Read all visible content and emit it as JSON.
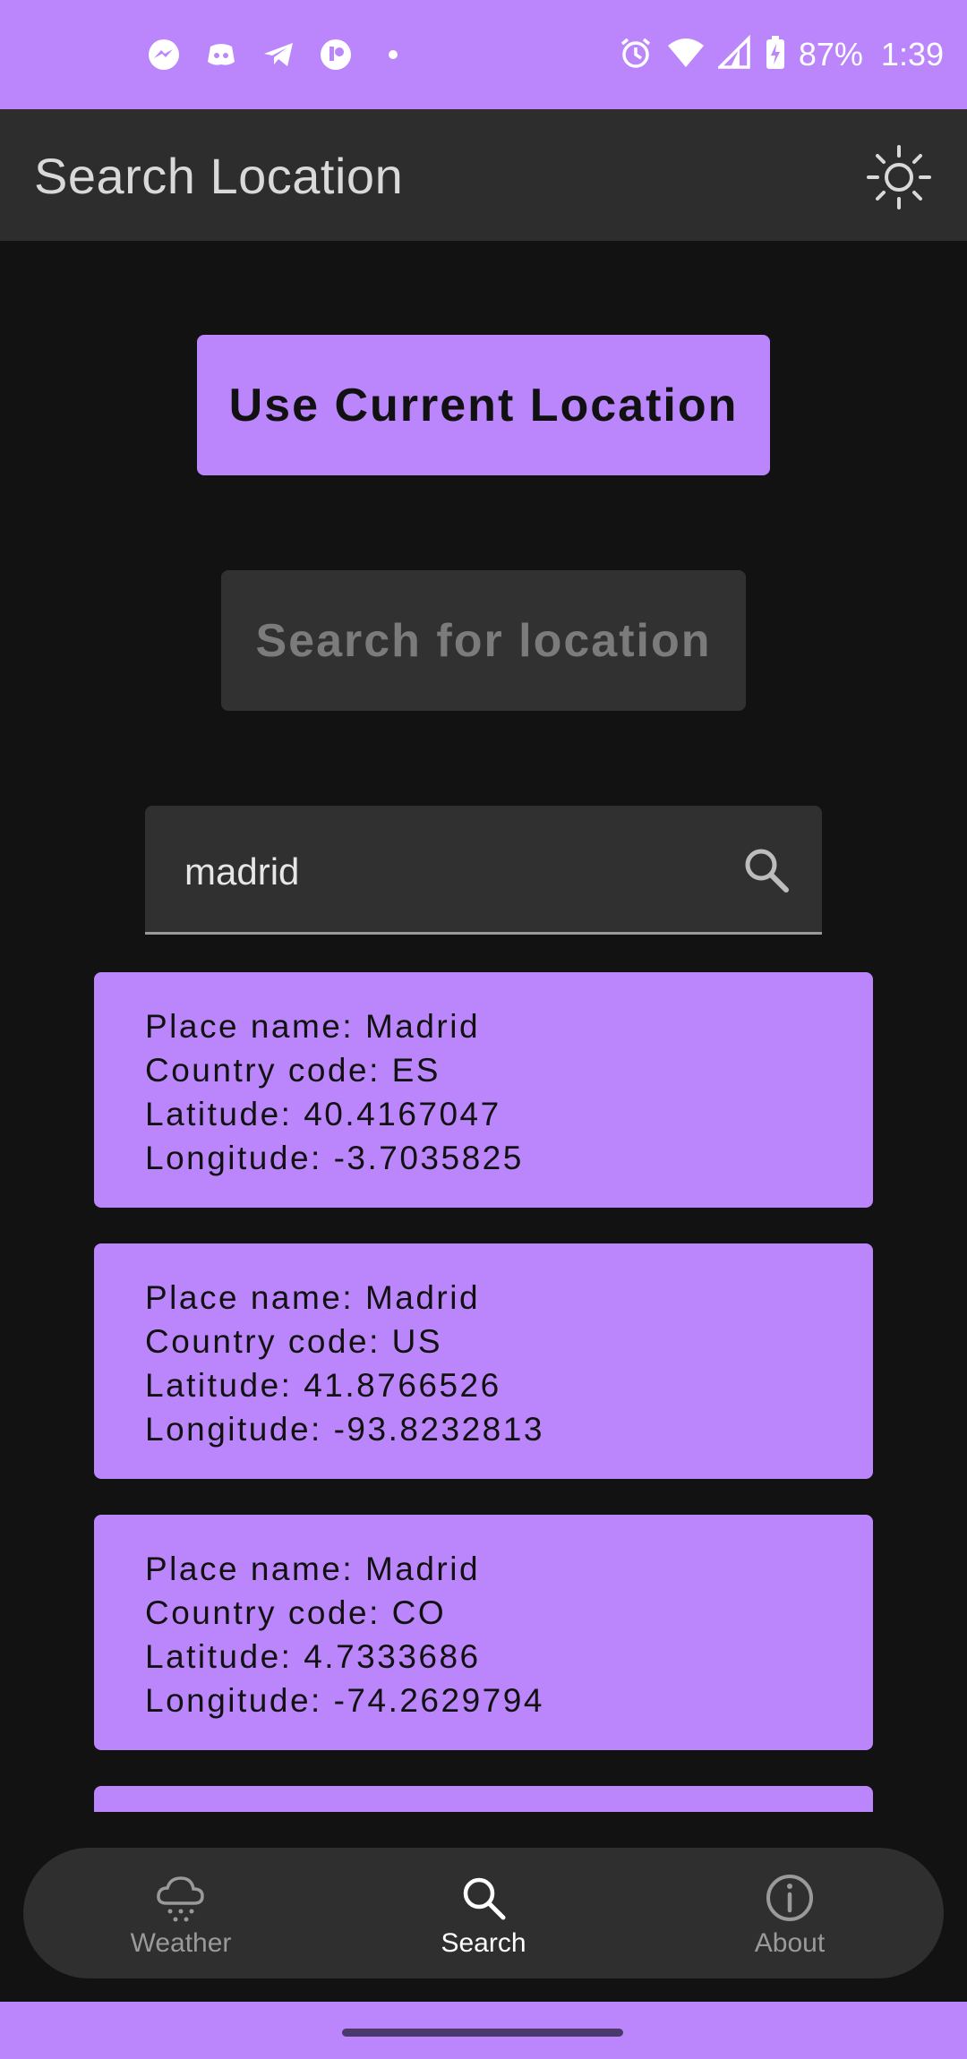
{
  "status_bar": {
    "notification_icons": [
      "messenger-icon",
      "discord-icon",
      "telegram-icon",
      "app-icon",
      "dot-icon"
    ],
    "system_icons": [
      "alarm-icon",
      "wifi-icon",
      "signal-icon",
      "battery-charging-icon"
    ],
    "battery_text": "87%",
    "time": "1:39"
  },
  "app_bar": {
    "title": "Search Location",
    "action_icon": "brightness-icon"
  },
  "buttons": {
    "current_location_label": "Use Current Location",
    "search_location_label": "Search for location"
  },
  "search": {
    "value": "madrid",
    "icon": "search-icon"
  },
  "results": [
    {
      "place": "Place name: Madrid",
      "country": "Country code: ES",
      "lat": "Latitude: 40.4167047",
      "lon": "Longitude: -3.7035825"
    },
    {
      "place": "Place name: Madrid",
      "country": "Country code: US",
      "lat": "Latitude: 41.8766526",
      "lon": "Longitude: -93.8232813"
    },
    {
      "place": "Place name: Madrid",
      "country": "Country code: CO",
      "lat": "Latitude: 4.7333686",
      "lon": "Longitude: -74.2629794"
    }
  ],
  "bottom_nav": {
    "items": [
      {
        "label": "Weather",
        "icon": "cloud-rain-icon"
      },
      {
        "label": "Search",
        "icon": "search-icon"
      },
      {
        "label": "About",
        "icon": "info-icon"
      }
    ]
  },
  "colors": {
    "accent": "#bb86fc",
    "background": "#121212",
    "surface": "#2d2d2d"
  }
}
